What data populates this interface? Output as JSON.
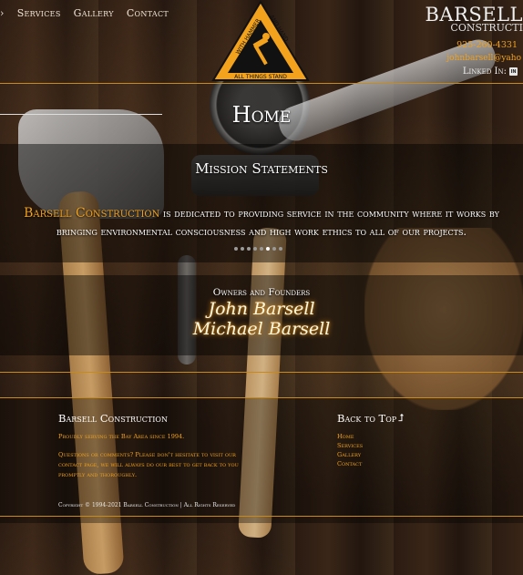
{
  "nav": {
    "items": [
      "Services",
      "Gallery",
      "Contact"
    ]
  },
  "logo": {
    "text_left": "WITH HAMMER",
    "text_right": "AND HAND",
    "text_bottom": "ALL THINGS STAND",
    "colors": {
      "orange": "#f2a21c",
      "black": "#111111"
    }
  },
  "brand": {
    "name": "BARSELL",
    "sub": "CONSTRUCTI"
  },
  "contact": {
    "phone": "925-260-4331",
    "email": "johnbarsell@yaho",
    "linkedin_label": "Linked In:"
  },
  "page": {
    "title": "Home"
  },
  "mission": {
    "heading": "Mission Statements",
    "company": "Barsell Construction",
    "statement": " is dedicated to providing service in the community where it works by bringing environmental consciousness and high work ethics to all of our projects."
  },
  "carousel": {
    "total": 8,
    "active_index": 5
  },
  "owners": {
    "label": "Owners and Founders",
    "names": [
      "John Barsell",
      "Michael Barsell"
    ]
  },
  "footer": {
    "brand": "Barsell Construction",
    "tagline": "Proudly serving the Bay Area since 1994.",
    "questions": "Questions or comments? Please don't hesitate to visit our contact page, we will always do our best to get back to you promptly and thoroughly.",
    "back_to_top": "Back to Top",
    "links": [
      "Home",
      "Services",
      "Gallery",
      "Contact"
    ],
    "copyright": "Copyright © 1994-2021 Barsell Construction | All Rights Reserved"
  },
  "colors": {
    "accent": "#f2a21c",
    "divider": "#c98a1c"
  }
}
